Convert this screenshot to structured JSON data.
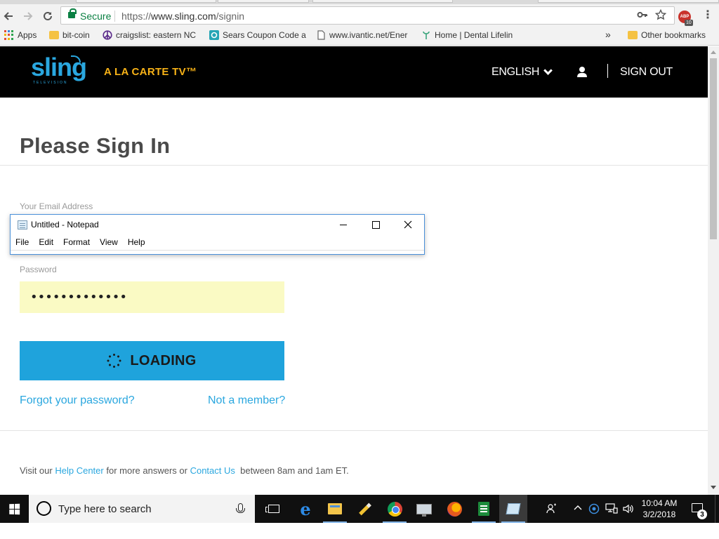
{
  "browser": {
    "security_label": "Secure",
    "url_scheme": "https://",
    "url_host": "www.sling.com",
    "url_path": "/signin",
    "extension_label": "ABP",
    "extension_badge": "10",
    "bookmarks": [
      {
        "label": "Apps",
        "icon": "apps-grid-icon"
      },
      {
        "label": "bit-coin",
        "icon": "folder-icon"
      },
      {
        "label": "craigslist: eastern NC",
        "icon": "peace-icon"
      },
      {
        "label": "Sears Coupon Code a",
        "icon": "coupon-icon"
      },
      {
        "label": "www.ivantic.net/Ener",
        "icon": "page-icon"
      },
      {
        "label": "Home | Dental Lifelin",
        "icon": "dental-icon"
      }
    ],
    "bookmarks_overflow": "»",
    "other_bookmarks": "Other bookmarks"
  },
  "header": {
    "logo_text": "sling",
    "logo_subtext": "TELEVISION",
    "tagline": "A LA CARTE TV™",
    "language": "ENGLISH",
    "sign_out": "SIGN OUT",
    "brand_color": "#2aa7df",
    "tagline_color": "#f7b217"
  },
  "signin": {
    "title": "Please Sign In",
    "email_label": "Your Email Address",
    "email_value": "",
    "password_label": "Password",
    "password_value": "•••••••••••••",
    "loading_label": "LOADING",
    "forgot_link": "Forgot your password?",
    "member_link": "Not a member?",
    "help_prefix": "Visit our",
    "help_center": "Help Center",
    "help_middle": "for more answers or",
    "contact_us": "Contact Us",
    "help_suffix": "between 8am and 1am ET."
  },
  "notepad": {
    "title": "Untitled - Notepad",
    "menus": [
      "File",
      "Edit",
      "Format",
      "View",
      "Help"
    ]
  },
  "taskbar": {
    "search_placeholder": "Type here to search",
    "apps": [
      {
        "name": "task-view-icon",
        "active": false
      },
      {
        "name": "edge-icon",
        "active": false
      },
      {
        "name": "file-explorer-icon",
        "active": false
      },
      {
        "name": "pen-app-icon",
        "active": false
      },
      {
        "name": "chrome-icon",
        "active": false
      },
      {
        "name": "this-pc-icon",
        "active": false
      },
      {
        "name": "firefox-icon",
        "active": false
      },
      {
        "name": "sheets-icon",
        "active": false
      },
      {
        "name": "notepad-icon",
        "active": true
      }
    ],
    "time": "10:04 AM",
    "date": "3/2/2018",
    "notification_count": "3"
  }
}
